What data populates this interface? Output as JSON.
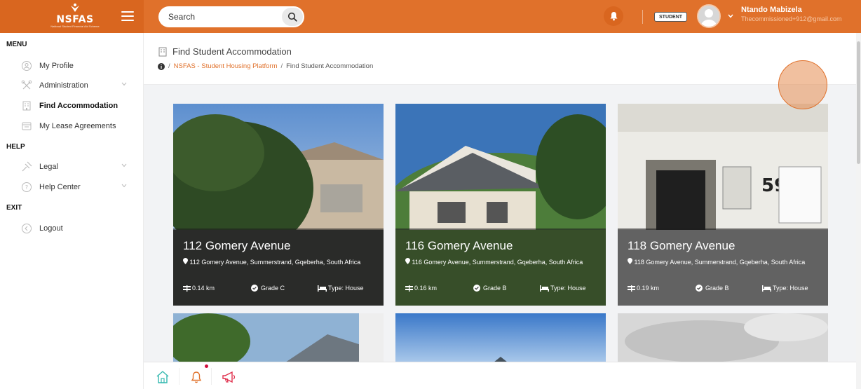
{
  "brand": {
    "logo_text": "NSFAS",
    "logo_tagline": "National Student Financial Aid Scheme"
  },
  "search": {
    "placeholder": "Search"
  },
  "user": {
    "role": "STUDENT",
    "name": "Ntando Mabizela",
    "email": "Thecommissioned+912@gmail.com"
  },
  "sidebar": {
    "sections": [
      {
        "title": "MENU",
        "items": [
          {
            "label": "My Profile",
            "icon": "user-circle-icon"
          },
          {
            "label": "Administration",
            "icon": "tools-icon",
            "has_submenu": true
          },
          {
            "label": "Find Accommodation",
            "icon": "building-icon",
            "active": true
          },
          {
            "label": "My Lease Agreements",
            "icon": "document-icon"
          }
        ]
      },
      {
        "title": "HELP",
        "items": [
          {
            "label": "Legal",
            "icon": "gavel-icon",
            "has_submenu": true
          },
          {
            "label": "Help Center",
            "icon": "question-circle-icon",
            "has_submenu": true
          }
        ]
      },
      {
        "title": "EXIT",
        "items": [
          {
            "label": "Logout",
            "icon": "logout-icon"
          }
        ]
      }
    ]
  },
  "page": {
    "title": "Find Student Accommodation",
    "breadcrumb": [
      {
        "label": "NSFAS - Student Housing Platform",
        "link": true
      },
      {
        "label": "Find Student Accommodation",
        "link": false
      }
    ]
  },
  "listings": [
    {
      "title": "112 Gomery Avenue",
      "address": "112 Gomery Avenue, Summerstrand, Gqeberha, South Africa",
      "distance": "0.14 km",
      "grade": "Grade C",
      "type": "Type: House"
    },
    {
      "title": "116 Gomery Avenue",
      "address": "116 Gomery Avenue, Summerstrand, Gqeberha, South Africa",
      "distance": "0.16 km",
      "grade": "Grade B",
      "type": "Type: House"
    },
    {
      "title": "118 Gomery Avenue",
      "address": "118 Gomery Avenue, Summerstrand, Gqeberha, South Africa",
      "distance": "0.19 km",
      "grade": "Grade B",
      "type": "Type: House"
    }
  ],
  "bottom_nav": [
    "home-icon",
    "bell-icon",
    "megaphone-icon"
  ],
  "colors": {
    "accent": "#e0712b",
    "accent_dark": "#d9661f",
    "sidebar_bg": "#ffffff",
    "notification_dot": "#d10f3d"
  }
}
